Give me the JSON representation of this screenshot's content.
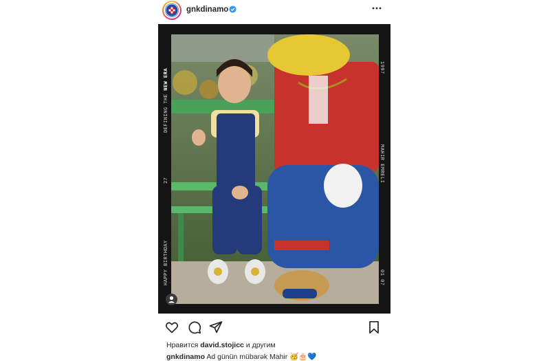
{
  "header": {
    "username": "gnkdinamo",
    "verified": true
  },
  "photo": {
    "left_text_1": "DEFINING THE",
    "left_text_2": "NEW ERA",
    "left_number": "27",
    "left_text_3": "HAPPY BIRTHDAY",
    "right_year": "1997",
    "right_name": "MAHIR EMRELI",
    "right_date": "01 07"
  },
  "likes": {
    "prefix": "Нравится",
    "user": "david.stojicc",
    "suffix": "и другим"
  },
  "caption": {
    "username": "gnkdinamo",
    "text": "Ad günün mübarək Mahir 🥳🎂💙"
  },
  "colors": {
    "frame": "#141414",
    "verified": "#3897f0",
    "club_blue": "#1f4fa8"
  }
}
